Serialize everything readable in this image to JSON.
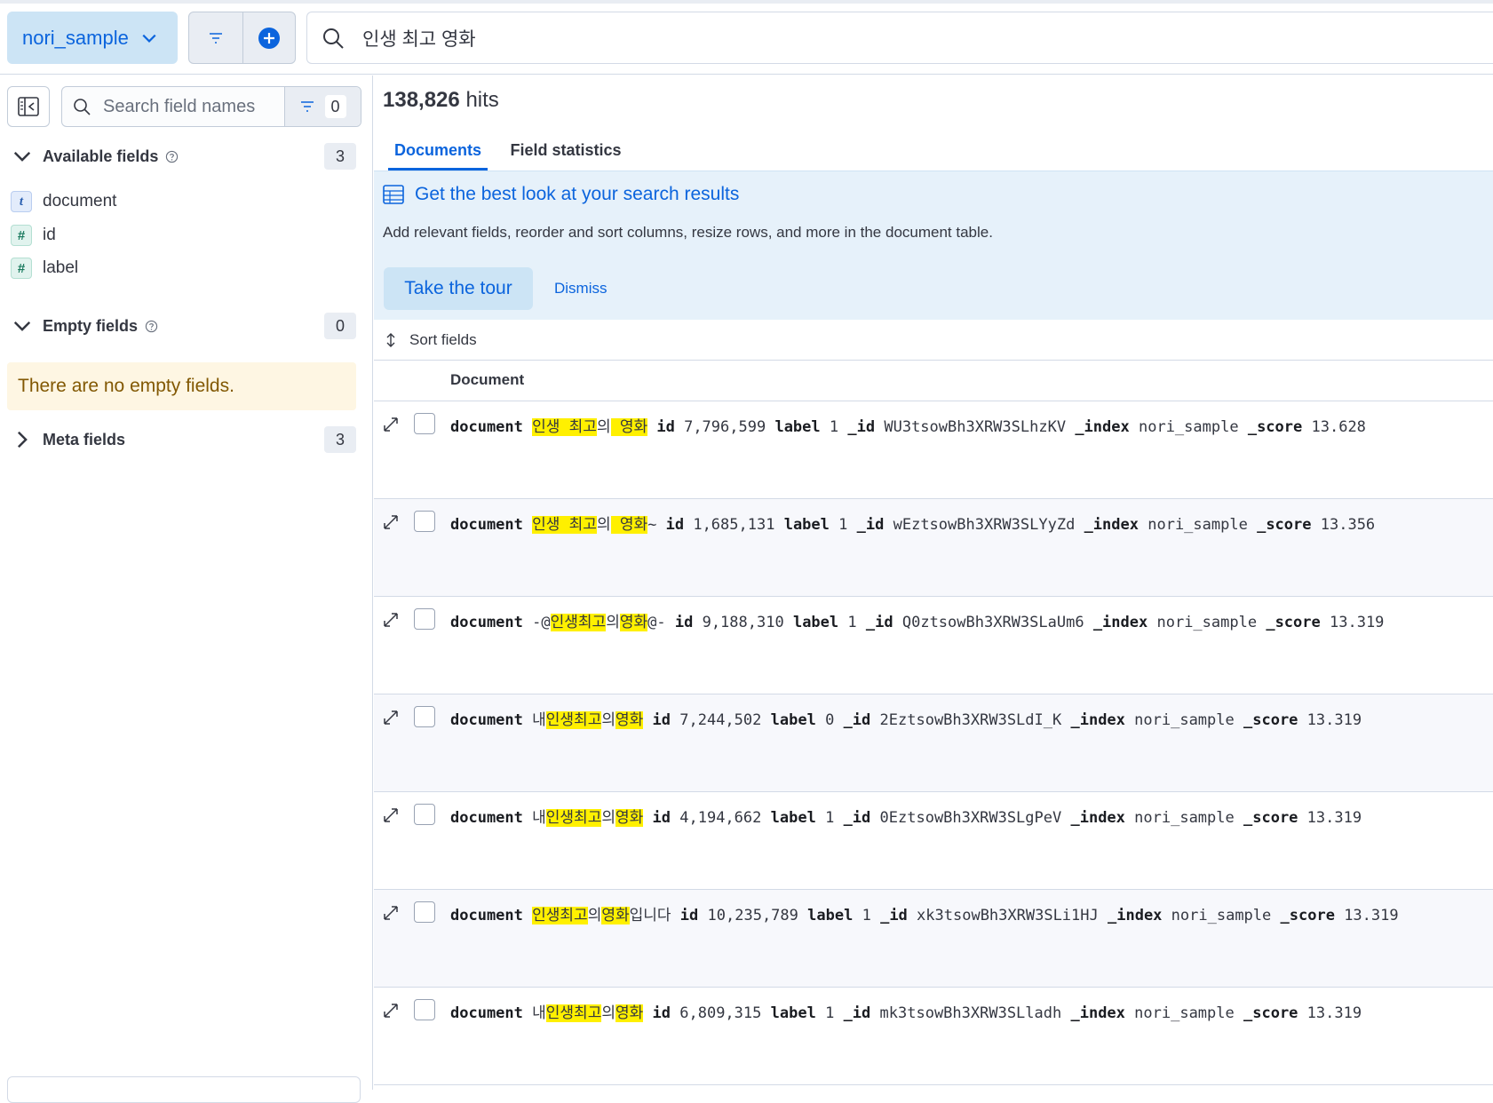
{
  "topbar": {
    "data_view": "nori_sample",
    "query": "인생 최고 영화"
  },
  "sidebar": {
    "search_placeholder": "Search field names",
    "filter_count": "0",
    "available": {
      "title": "Available fields",
      "count": "3",
      "fields": [
        {
          "type": "t",
          "name": "document"
        },
        {
          "type": "#",
          "name": "id"
        },
        {
          "type": "#",
          "name": "label"
        }
      ]
    },
    "empty": {
      "title": "Empty fields",
      "count": "0",
      "message": "There are no empty fields."
    },
    "meta": {
      "title": "Meta fields",
      "count": "3"
    }
  },
  "main": {
    "hits_count": "138,826",
    "hits_label": "hits",
    "tabs": [
      {
        "label": "Documents"
      },
      {
        "label": "Field statistics"
      }
    ],
    "tour": {
      "title": "Get the best look at your search results",
      "description": "Add relevant fields, reorder and sort columns, resize rows, and more in the document table.",
      "primary": "Take the tour",
      "dismiss": "Dismiss"
    },
    "sort_label": "Sort fields",
    "column_header": "Document",
    "rows": [
      {
        "document": [
          [
            "인생 최고",
            true
          ],
          [
            "의",
            false
          ],
          [
            " 영화",
            true
          ]
        ],
        "id": "7,796,599",
        "label": "1",
        "_id": "WU3tsowBh3XRW3SLhzKV",
        "_index": "nori_sample",
        "_score": "13.628"
      },
      {
        "document": [
          [
            "인생 최고",
            true
          ],
          [
            "의",
            false
          ],
          [
            " 영화",
            true
          ],
          [
            "~",
            false
          ]
        ],
        "id": "1,685,131",
        "label": "1",
        "_id": "wEztsowBh3XRW3SLYyZd",
        "_index": "nori_sample",
        "_score": "13.356"
      },
      {
        "document": [
          [
            "-@",
            false
          ],
          [
            "인생최고",
            true
          ],
          [
            "의",
            false
          ],
          [
            "영화",
            true
          ],
          [
            "@-",
            false
          ]
        ],
        "id": "9,188,310",
        "label": "1",
        "_id": "Q0ztsowBh3XRW3SLaUm6",
        "_index": "nori_sample",
        "_score": "13.319"
      },
      {
        "document": [
          [
            "내",
            false
          ],
          [
            "인생최고",
            true
          ],
          [
            "의",
            false
          ],
          [
            "영화",
            true
          ]
        ],
        "id": "7,244,502",
        "label": "0",
        "_id": "2EztsowBh3XRW3SLdI_K",
        "_index": "nori_sample",
        "_score": "13.319"
      },
      {
        "document": [
          [
            "내",
            false
          ],
          [
            "인생최고",
            true
          ],
          [
            "의",
            false
          ],
          [
            "영화",
            true
          ]
        ],
        "id": "4,194,662",
        "label": "1",
        "_id": "0EztsowBh3XRW3SLgPeV",
        "_index": "nori_sample",
        "_score": "13.319"
      },
      {
        "document": [
          [
            "인생최고",
            true
          ],
          [
            "의",
            false
          ],
          [
            "영화",
            true
          ],
          [
            "입니다",
            false
          ]
        ],
        "id": "10,235,789",
        "label": "1",
        "_id": "xk3tsowBh3XRW3SLi1HJ",
        "_index": "nori_sample",
        "_score": "13.319"
      },
      {
        "document": [
          [
            "내",
            false
          ],
          [
            "인생최고",
            true
          ],
          [
            "의",
            false
          ],
          [
            "영화",
            true
          ]
        ],
        "id": "6,809,315",
        "label": "1",
        "_id": "mk3tsowBh3XRW3SLladh",
        "_index": "nori_sample",
        "_score": "13.319"
      }
    ]
  },
  "colors": {
    "accent": "#0b64dd",
    "highlight": "#fff000",
    "tour_bg": "#e6f1fa",
    "empty_bg": "#fef6e3"
  }
}
